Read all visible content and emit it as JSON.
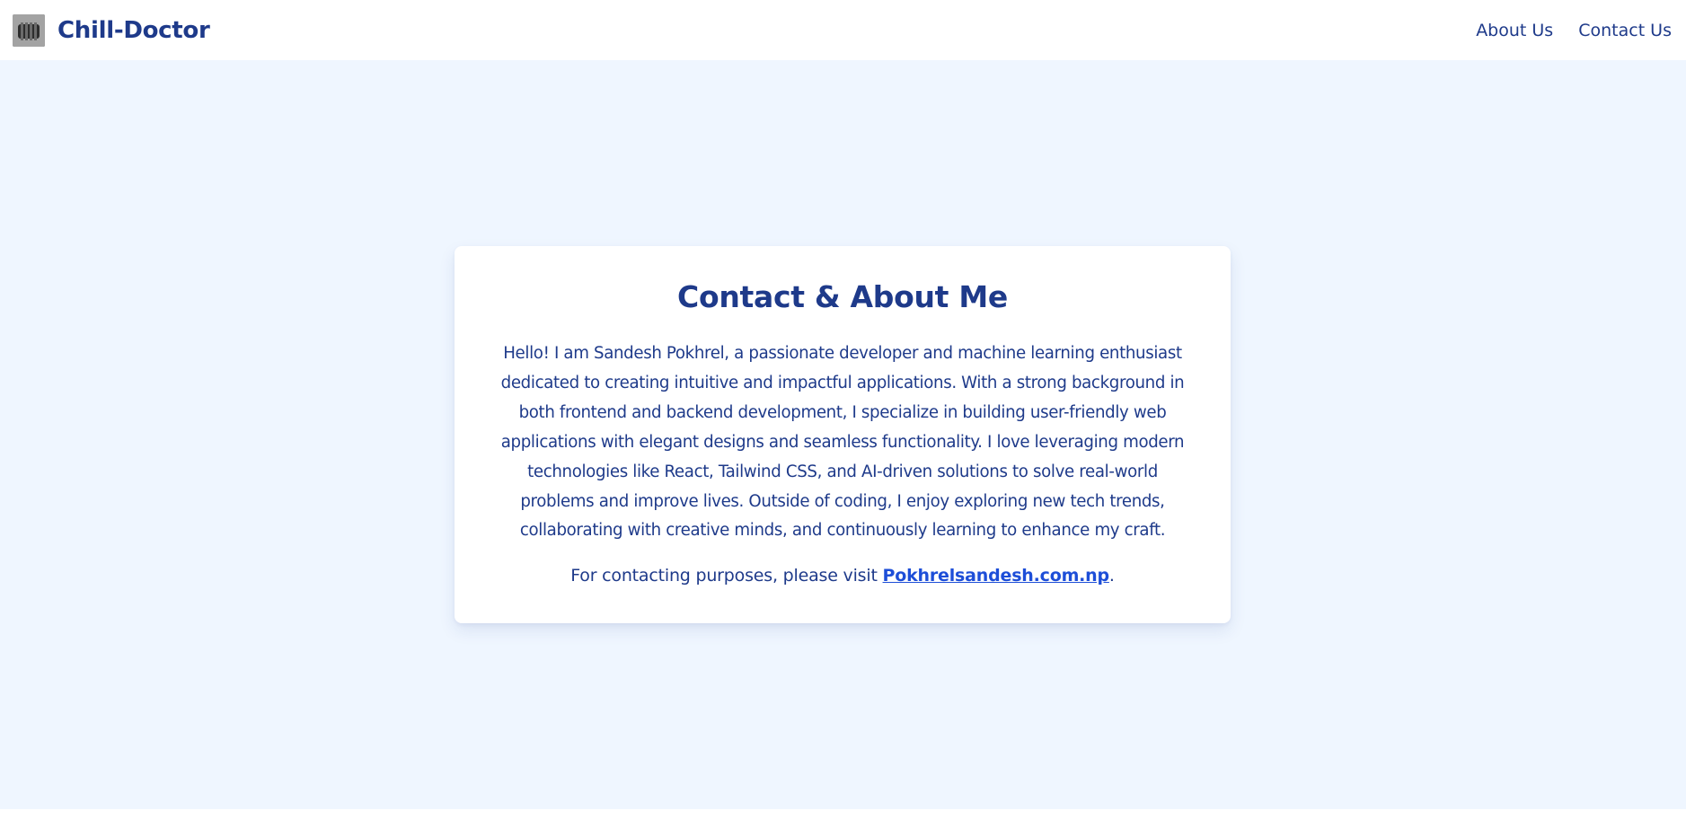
{
  "header": {
    "brand_name": "Chill-Doctor",
    "logo_icon": "brain-logo-icon",
    "nav": [
      {
        "label": "About Us"
      },
      {
        "label": "Contact Us"
      }
    ]
  },
  "card": {
    "title": "Contact & About Me",
    "bio": "Hello! I am Sandesh Pokhrel, a passionate developer and machine learning enthusiast dedicated to creating intuitive and impactful applications. With a strong background in both frontend and backend development, I specialize in building user-friendly web applications with elegant designs and seamless functionality. I love leveraging modern technologies like React, Tailwind CSS, and AI-driven solutions to solve real-world problems and improve lives. Outside of coding, I enjoy exploring new tech trends, collaborating with creative minds, and continuously learning to enhance my craft.",
    "contact_prefix": "For contacting purposes, please visit ",
    "contact_link": "Pokhrelsandesh.com.np",
    "contact_suffix": "."
  },
  "colors": {
    "brand": "#1e3a8a",
    "link": "#1d4ed8",
    "page_background": "#eff6ff",
    "card_background": "#ffffff"
  }
}
